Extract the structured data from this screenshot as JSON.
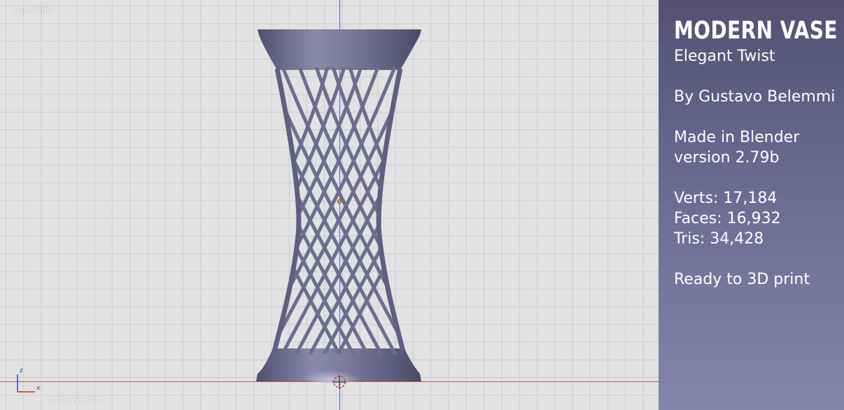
{
  "viewport": {
    "view_label": "Front Ortho",
    "object_label": "(2) Cylinder014",
    "gizmo": {
      "z_label": "z",
      "x_label": "x"
    }
  },
  "info_panel": {
    "title": "MODERN VASE",
    "subtitle": "Elegant Twist",
    "author": "By Gustavo Belemmi",
    "made_in": "Made in Blender",
    "version": "version 2.79b",
    "verts": "Verts: 17,184",
    "faces": "Faces: 16,932",
    "tris": "Tris: 34,428",
    "note": "Ready to 3D print"
  },
  "colors": {
    "viewport_bg": "#e2e2e2",
    "grid_line": "#cbcbcb",
    "vase": "#6f6f92",
    "panel_top": "#535073",
    "panel_bottom": "#8584aa",
    "z_axis": "#5a5ad8",
    "x_axis": "#d24b4b"
  }
}
